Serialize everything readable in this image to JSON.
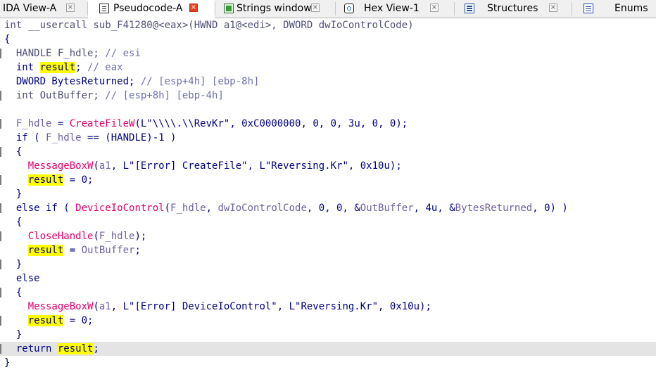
{
  "tabs": [
    {
      "label": "IDA View-A",
      "icon": "ida-view-icon"
    },
    {
      "label": "Pseudocode-A",
      "icon": "pseudocode-icon"
    },
    {
      "label": "Strings window",
      "icon": "strings-icon"
    },
    {
      "label": "Hex View-1",
      "icon": "hex-view-icon"
    },
    {
      "label": "Structures",
      "icon": "structures-icon"
    },
    {
      "label": "Enums",
      "icon": "enums-icon"
    }
  ],
  "active_tab": "Pseudocode-A",
  "colors": {
    "highlight": "#ffff00",
    "current_line": "#e4e4e4",
    "keyword": "#000080",
    "function": "#e0006c",
    "variable": "#7060a0",
    "comment": "#7070b0"
  },
  "code": {
    "l0": {
      "a": "int __usercall sub_F41280@<eax>(HWND a1@<edi>, DWORD dwIoControlCode)"
    },
    "l1": {
      "a": "{"
    },
    "l2": {
      "a": "  HANDLE F_hdle; ",
      "c": "// esi"
    },
    "l3": {
      "a": "  int ",
      "h": "result",
      "b": "; ",
      "c": "// eax"
    },
    "l4": {
      "a": "  DWORD BytesReturned; ",
      "c": "// [esp+4h] [ebp-8h]"
    },
    "l5": {
      "a": "  int OutBuffer; ",
      "c": "// [esp+8h] [ebp-4h]"
    },
    "l6": {
      "a": ""
    },
    "l7": {
      "v": "F_hdle",
      "a": " = ",
      "f": "CreateFileW",
      "b": "(L\"\\\\\\\\.\\\\RevKr\", 0xC0000000, 0, 0, 3u, 0, 0);"
    },
    "l8": {
      "a": "  if ( ",
      "v": "F_hdle",
      "b": " == (HANDLE)-1 )"
    },
    "l9": {
      "a": "  {"
    },
    "l10": {
      "f": "MessageBoxW",
      "a": "(",
      "v": "a1",
      "b": ", L\"[Error] CreateFile\", L\"Reversing.Kr\", 0x10u);"
    },
    "l11": {
      "h": "result",
      "b": " = 0;"
    },
    "l12": {
      "a": "  }"
    },
    "l13": {
      "a": "  else if ( ",
      "f": "DeviceIoControl",
      "b": "(",
      "v": "F_hdle",
      "c": ", ",
      "v2": "dwIoControlCode",
      "d": ", 0, 0, &",
      "v3": "OutBuffer",
      "e": ", 4u, &",
      "v4": "BytesReturned",
      "g": ", 0) )"
    },
    "l14": {
      "a": "  {"
    },
    "l15": {
      "f": "CloseHandle",
      "a": "(",
      "v": "F_hdle",
      "b": ");"
    },
    "l16": {
      "h": "result",
      "b": " = ",
      "v": "OutBuffer",
      "c": ";"
    },
    "l17": {
      "a": "  }"
    },
    "l18": {
      "a": "  else"
    },
    "l19": {
      "a": "  {"
    },
    "l20": {
      "f": "MessageBoxW",
      "a": "(",
      "v": "a1",
      "b": ", L\"[Error] DeviceIoControl\", L\"Reversing.Kr\", 0x10u);"
    },
    "l21": {
      "h": "result",
      "b": " = 0;"
    },
    "l22": {
      "a": "  }"
    },
    "l23": {
      "a": "  return ",
      "h": "result",
      "b": ";"
    },
    "l24": {
      "a": "}"
    }
  }
}
